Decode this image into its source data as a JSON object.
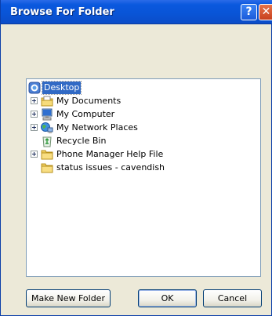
{
  "window": {
    "title": "Browse For Folder",
    "help_label": "?",
    "close_label": "✕",
    "instructions": ""
  },
  "tree": {
    "items": [
      {
        "label": "Desktop",
        "icon": "desktop-icon",
        "expandable": false,
        "selected": true
      },
      {
        "label": "My Documents",
        "icon": "my-documents-icon",
        "expandable": true
      },
      {
        "label": "My Computer",
        "icon": "my-computer-icon",
        "expandable": true
      },
      {
        "label": "My Network Places",
        "icon": "network-places-icon",
        "expandable": true
      },
      {
        "label": "Recycle Bin",
        "icon": "recycle-bin-icon",
        "expandable": false
      },
      {
        "label": "Phone Manager Help File",
        "icon": "folder-icon",
        "expandable": true
      },
      {
        "label": "status issues - cavendish",
        "icon": "folder-icon",
        "expandable": false
      }
    ]
  },
  "buttons": {
    "make_new_folder": "Make New Folder",
    "ok": "OK",
    "cancel": "Cancel"
  }
}
